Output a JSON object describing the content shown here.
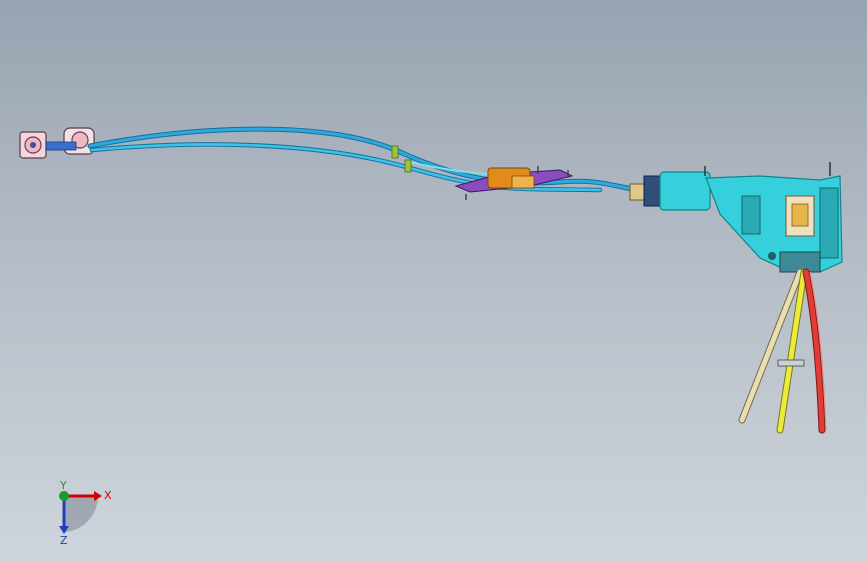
{
  "view": {
    "background_top": "#98a3b1",
    "background_bottom": "#cfd5dc"
  },
  "model": {
    "description_icon": "cable-assembly-3d-model",
    "colors": {
      "cable": "#2fa8dc",
      "cable_dark": "#146f9c",
      "housing": "#36d0dd",
      "housing_edge": "#14848c",
      "bracket": "#e38a1c",
      "purple": "#7a3aa8",
      "wire_tan": "#e6dfb5",
      "wire_yellow": "#ecea3c",
      "wire_red": "#e23c36",
      "connector_pink": "#efb9c2"
    }
  },
  "triad": {
    "x_label": "X",
    "y_label": "Y",
    "z_label": "Z",
    "x_color": "#d40000",
    "y_color": "#1a9a2c",
    "z_color": "#1f3fb8"
  }
}
